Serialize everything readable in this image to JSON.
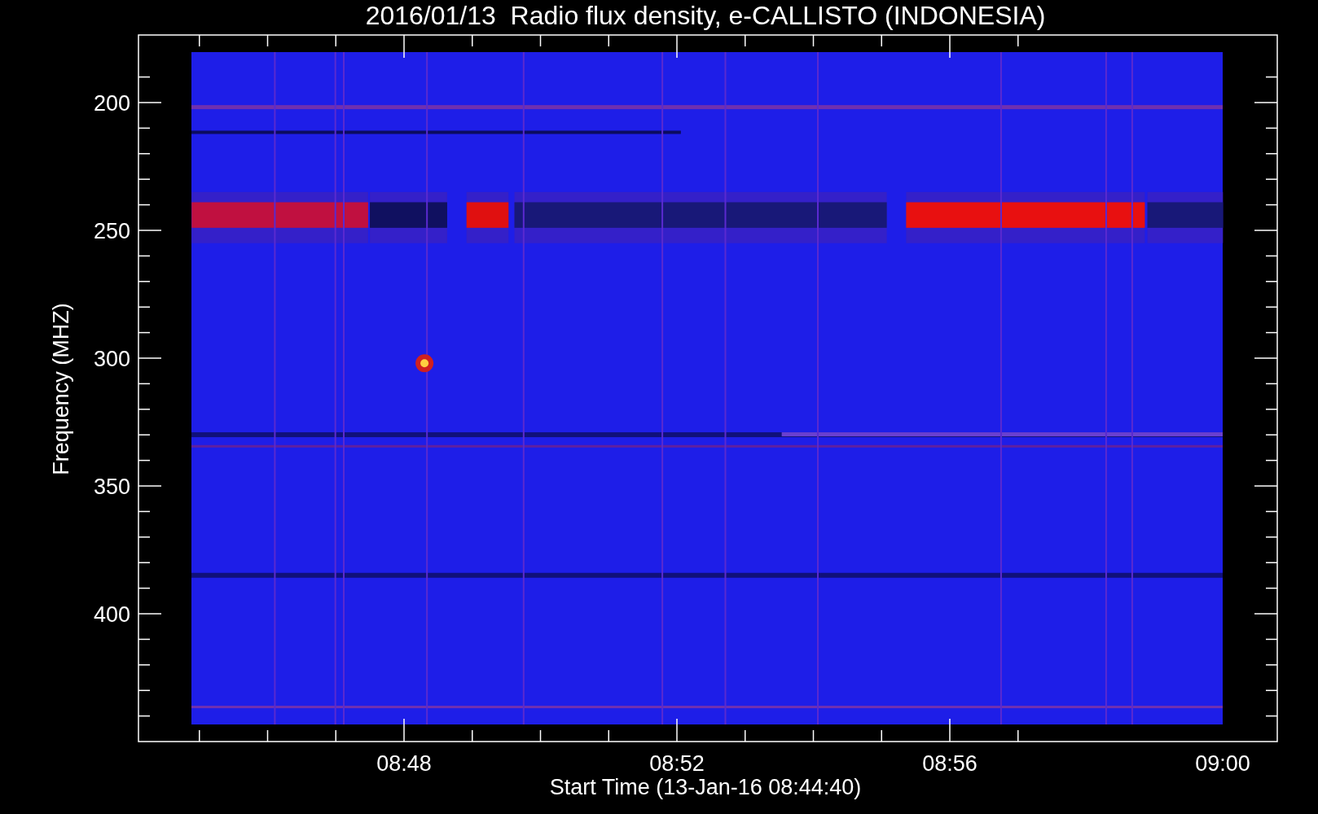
{
  "title": "2016/01/13  Radio flux density, e-CALLISTO (INDONESIA)",
  "y_axis": {
    "label": "Frequency (MHZ)",
    "ticks": [
      "200",
      "250",
      "300",
      "350",
      "400"
    ]
  },
  "x_axis": {
    "label": "Start Time (13-Jan-16 08:44:40)",
    "ticks": [
      "08:48",
      "08:52",
      "08:56",
      "09:00"
    ]
  }
}
